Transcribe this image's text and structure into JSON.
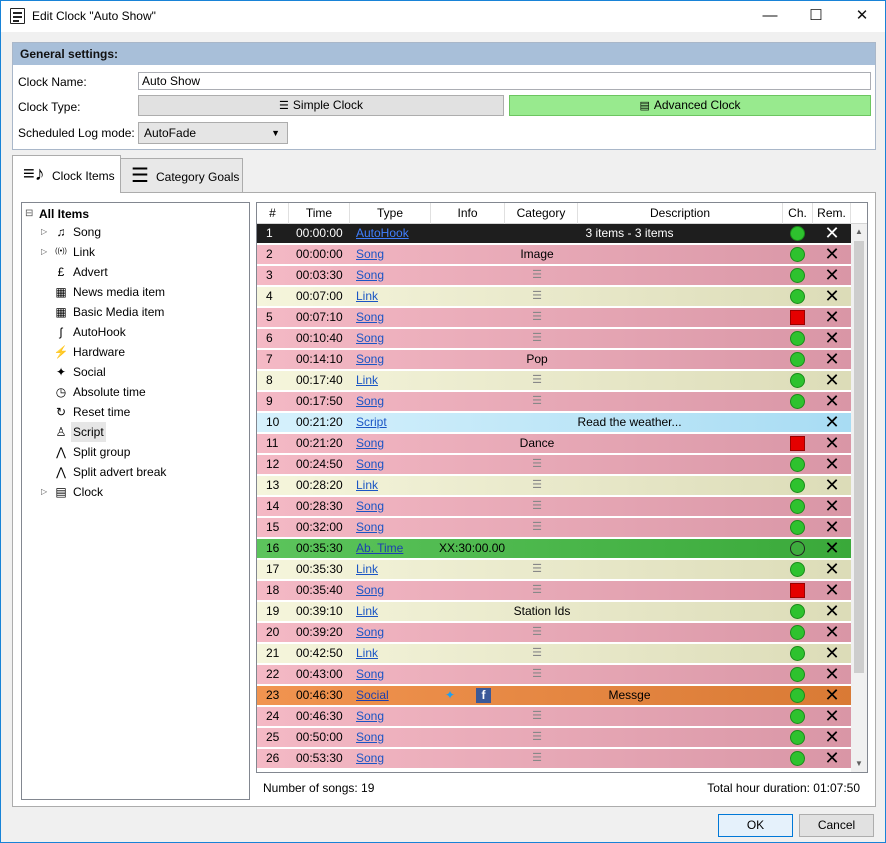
{
  "window": {
    "title": "Edit Clock \"Auto Show\"",
    "minimize": "—",
    "maximize": "☐",
    "close": "✕"
  },
  "general": {
    "header": "General settings:",
    "clock_name_label": "Clock Name:",
    "clock_name_value": "Auto Show",
    "clock_type_label": "Clock Type:",
    "simple_clock": "Simple Clock",
    "advanced_clock": "Advanced Clock",
    "log_mode_label": "Scheduled Log mode:",
    "log_mode_value": "AutoFade"
  },
  "tabs": [
    {
      "label": "Clock Items"
    },
    {
      "label": "Category Goals"
    }
  ],
  "tree": {
    "root": "All Items",
    "items": [
      {
        "label": "Song",
        "icon": "music-note-icon",
        "expandable": true
      },
      {
        "label": "Link",
        "icon": "broadcast-icon",
        "expandable": true
      },
      {
        "label": "Advert",
        "icon": "pound-icon",
        "expandable": false
      },
      {
        "label": "News media item",
        "icon": "newspaper-icon",
        "expandable": false
      },
      {
        "label": "Basic Media item",
        "icon": "media-icon",
        "expandable": false
      },
      {
        "label": "AutoHook",
        "icon": "hook-icon",
        "expandable": false
      },
      {
        "label": "Hardware",
        "icon": "plug-icon",
        "expandable": false
      },
      {
        "label": "Social",
        "icon": "twitter-icon",
        "expandable": false
      },
      {
        "label": "Absolute time",
        "icon": "clock-icon",
        "expandable": false
      },
      {
        "label": "Reset time",
        "icon": "reset-icon",
        "expandable": false
      },
      {
        "label": "Script",
        "icon": "person-icon",
        "expandable": false
      },
      {
        "label": "Split group",
        "icon": "split-icon",
        "expandable": false
      },
      {
        "label": "Split advert break",
        "icon": "split-advert-icon",
        "expandable": false
      },
      {
        "label": "Clock",
        "icon": "clock-doc-icon",
        "expandable": true
      }
    ]
  },
  "grid": {
    "columns": [
      "#",
      "Time",
      "Type",
      "Info",
      "Category",
      "Description",
      "Ch.",
      "Rem."
    ],
    "rows": [
      {
        "num": "1",
        "time": "00:00:00",
        "type": "AutoHook",
        "info": "",
        "category": "",
        "desc": "3 items - 3 items",
        "ch": "green",
        "style": "autohook"
      },
      {
        "num": "2",
        "time": "00:00:00",
        "type": "Song",
        "info": "",
        "category": "Image",
        "desc": "",
        "ch": "green",
        "style": "song"
      },
      {
        "num": "3",
        "time": "00:03:30",
        "type": "Song",
        "info": "",
        "category": "",
        "desc": "",
        "ch": "green",
        "style": "song",
        "cat_icon": true
      },
      {
        "num": "4",
        "time": "00:07:00",
        "type": "Link",
        "info": "",
        "category": "",
        "desc": "",
        "ch": "green",
        "style": "link",
        "cat_icon": true
      },
      {
        "num": "5",
        "time": "00:07:10",
        "type": "Song",
        "info": "",
        "category": "",
        "desc": "",
        "ch": "red",
        "style": "song",
        "cat_icon": true
      },
      {
        "num": "6",
        "time": "00:10:40",
        "type": "Song",
        "info": "",
        "category": "",
        "desc": "",
        "ch": "green",
        "style": "song",
        "cat_icon": true
      },
      {
        "num": "7",
        "time": "00:14:10",
        "type": "Song",
        "info": "",
        "category": "Pop",
        "desc": "",
        "ch": "green",
        "style": "song"
      },
      {
        "num": "8",
        "time": "00:17:40",
        "type": "Link",
        "info": "",
        "category": "",
        "desc": "",
        "ch": "green",
        "style": "link",
        "cat_icon": true
      },
      {
        "num": "9",
        "time": "00:17:50",
        "type": "Song",
        "info": "",
        "category": "",
        "desc": "",
        "ch": "green",
        "style": "song",
        "cat_icon": true
      },
      {
        "num": "10",
        "time": "00:21:20",
        "type": "Script",
        "info": "",
        "category": "",
        "desc": "Read the weather...",
        "ch": "none",
        "style": "script"
      },
      {
        "num": "11",
        "time": "00:21:20",
        "type": "Song",
        "info": "",
        "category": "Dance",
        "desc": "",
        "ch": "red",
        "style": "song"
      },
      {
        "num": "12",
        "time": "00:24:50",
        "type": "Song",
        "info": "",
        "category": "",
        "desc": "",
        "ch": "green",
        "style": "song",
        "cat_icon": true
      },
      {
        "num": "13",
        "time": "00:28:20",
        "type": "Link",
        "info": "",
        "category": "",
        "desc": "",
        "ch": "green",
        "style": "link",
        "cat_icon": true
      },
      {
        "num": "14",
        "time": "00:28:30",
        "type": "Song",
        "info": "",
        "category": "",
        "desc": "",
        "ch": "green",
        "style": "song",
        "cat_icon": true
      },
      {
        "num": "15",
        "time": "00:32:00",
        "type": "Song",
        "info": "",
        "category": "",
        "desc": "",
        "ch": "green",
        "style": "song",
        "cat_icon": true
      },
      {
        "num": "16",
        "time": "00:35:30",
        "type": "Ab. Time",
        "info": "XX:30:00.00",
        "category": "",
        "desc": "",
        "ch": "empty",
        "style": "abtime"
      },
      {
        "num": "17",
        "time": "00:35:30",
        "type": "Link",
        "info": "",
        "category": "",
        "desc": "",
        "ch": "green",
        "style": "link",
        "cat_icon": true
      },
      {
        "num": "18",
        "time": "00:35:40",
        "type": "Song",
        "info": "",
        "category": "",
        "desc": "",
        "ch": "red",
        "style": "song",
        "cat_icon": true
      },
      {
        "num": "19",
        "time": "00:39:10",
        "type": "Link",
        "info": "",
        "category": "Station Ids",
        "desc": "",
        "ch": "green",
        "style": "link"
      },
      {
        "num": "20",
        "time": "00:39:20",
        "type": "Song",
        "info": "",
        "category": "",
        "desc": "",
        "ch": "green",
        "style": "song",
        "cat_icon": true
      },
      {
        "num": "21",
        "time": "00:42:50",
        "type": "Link",
        "info": "",
        "category": "",
        "desc": "",
        "ch": "green",
        "style": "link",
        "cat_icon": true
      },
      {
        "num": "22",
        "time": "00:43:00",
        "type": "Song",
        "info": "",
        "category": "",
        "desc": "",
        "ch": "green",
        "style": "song",
        "cat_icon": true
      },
      {
        "num": "23",
        "time": "00:46:30",
        "type": "Social",
        "info": "",
        "category": "",
        "desc": "Messge",
        "ch": "green",
        "style": "social",
        "social_icons": true
      },
      {
        "num": "24",
        "time": "00:46:30",
        "type": "Song",
        "info": "",
        "category": "",
        "desc": "",
        "ch": "green",
        "style": "song",
        "cat_icon": true
      },
      {
        "num": "25",
        "time": "00:50:00",
        "type": "Song",
        "info": "",
        "category": "",
        "desc": "",
        "ch": "green",
        "style": "song",
        "cat_icon": true
      },
      {
        "num": "26",
        "time": "00:53:30",
        "type": "Song",
        "info": "",
        "category": "",
        "desc": "",
        "ch": "green",
        "style": "song",
        "cat_icon": true
      }
    ]
  },
  "footer": {
    "songs": "Number of songs: 19",
    "duration": "Total hour duration: 01:07:50"
  },
  "buttons": {
    "ok": "OK",
    "cancel": "Cancel"
  },
  "colors": {
    "song": "#f2b6c3",
    "link": "#f2f2d2",
    "autohook": "#1e1e1e",
    "script": "#c6ecfa",
    "abtime": "#4fbf4f",
    "social": "#ef8a45",
    "header": "#a8bfd9",
    "advanced_button": "#98ea8e"
  }
}
